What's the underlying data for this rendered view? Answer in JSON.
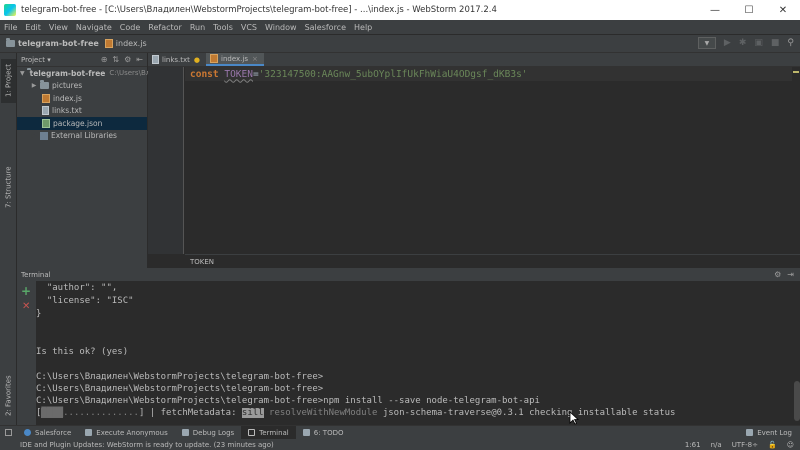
{
  "window": {
    "title": "telegram-bot-free - [C:\\Users\\Владилен\\WebstormProjects\\telegram-bot-free] - ...\\index.js - WebStorm 2017.2.4",
    "controls": [
      "—",
      "☐",
      "✕"
    ]
  },
  "menu": [
    "File",
    "Edit",
    "View",
    "Navigate",
    "Code",
    "Refactor",
    "Run",
    "Tools",
    "VCS",
    "Window",
    "Salesforce",
    "Help"
  ],
  "navbar": {
    "project": "telegram-bot-free",
    "file": "index.js"
  },
  "sidebar_tabs": {
    "project": "1: Project",
    "structure": "7: Structure",
    "favorites": "2: Favorites"
  },
  "project_panel": {
    "view_selector": "Project",
    "tree": [
      {
        "label": "telegram-bot-free",
        "path": "C:\\Users\\Вл",
        "kind": "folder",
        "expanded": true,
        "level": 0
      },
      {
        "label": "pictures",
        "kind": "folder",
        "expanded": false,
        "level": 1
      },
      {
        "label": "index.js",
        "kind": "js",
        "level": 1
      },
      {
        "label": "links.txt",
        "kind": "txt",
        "level": 1
      },
      {
        "label": "package.json",
        "kind": "json",
        "level": 1,
        "selected": true
      },
      {
        "label": "External Libraries",
        "kind": "lib",
        "level": 0
      }
    ]
  },
  "editor": {
    "tabs": [
      {
        "label": "links.txt",
        "active": false
      },
      {
        "label": "index.js",
        "active": true
      }
    ],
    "code": {
      "keyword": "const",
      "identifier": "TOKEN",
      "operator": " = ",
      "string": "'323147500:AAGnw_5ubOYplIfUkFhWiaU4ODgsf_dKB3s'"
    },
    "breadcrumb": "TOKEN"
  },
  "terminal": {
    "title": "Terminal",
    "lines": [
      "  \"author\": \"\",",
      "  \"license\": \"ISC\"",
      "}",
      "",
      "Is this ok? (yes)",
      "",
      "C:\\Users\\Владилен\\WebstormProjects\\telegram-bot-free>",
      "C:\\Users\\Владилен\\WebstormProjects\\telegram-bot-free>",
      "C:\\Users\\Владилен\\WebstormProjects\\telegram-bot-free>npm install --save node-telegram-bot-api"
    ],
    "progress": {
      "open": "[",
      "bar_filled": "████",
      "bar_rest": "..............",
      "close": "] | fetchMetadata: ",
      "level": "sill",
      "rest1": " resolveWithNewModule",
      "rest2": " json-schema-traverse@0.3.1 checking installable status"
    }
  },
  "bottom_tools": [
    {
      "label": "Salesforce",
      "color": "#4a88c7",
      "active": false
    },
    {
      "label": "Execute Anonymous",
      "color": "#9aa7b0",
      "active": false
    },
    {
      "label": "Debug Logs",
      "color": "#9aa7b0",
      "active": false
    },
    {
      "label": "Terminal",
      "color": "#bbbbbb",
      "active": true
    },
    {
      "label": "6: TODO",
      "color": "#9aa7b0",
      "active": false
    }
  ],
  "event_log": "Event Log",
  "status": {
    "message": "IDE and Plugin Updates: WebStorm is ready to update. (23 minutes ago)",
    "position": "1:61",
    "line_sep": "n/a",
    "encoding": "UTF-8÷"
  },
  "colors": {
    "keyword": "#cc7832",
    "identifier": "#9876aa",
    "string": "#6a8759",
    "selection": "#0d293e"
  }
}
